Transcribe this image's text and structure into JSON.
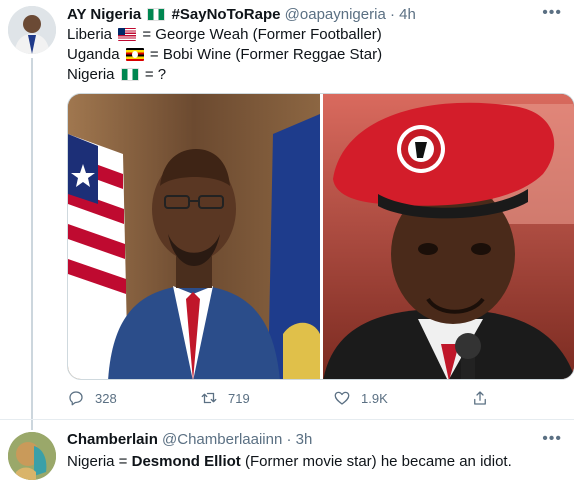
{
  "tweet": {
    "name": "AY Nigeria",
    "name_suffix": "#SayNoToRape",
    "handle": "@oapaynigeria",
    "separator": "·",
    "time": "4h",
    "lines": [
      {
        "prefix": "Liberia",
        "suffix": "= George Weah (Former Footballer)"
      },
      {
        "prefix": "Uganda",
        "suffix": "= Bobi Wine (Former Reggae Star)"
      },
      {
        "prefix": "Nigeria",
        "suffix": "= ?"
      }
    ],
    "flags": [
      "nigeria-flag-icon",
      "liberia-flag-icon",
      "uganda-flag-icon",
      "nigeria-flag-icon"
    ],
    "actions": {
      "replies": "328",
      "retweets": "719",
      "likes": "1.9K"
    }
  },
  "reply": {
    "name": "Chamberlain",
    "handle": "@Chamberlaaiinn",
    "separator": "·",
    "time": "3h",
    "text_before": "Nigeria =",
    "text_bold": "Desmond Elliot",
    "text_after": "(Former movie star) he became an idiot."
  },
  "colors": {
    "secondary_text": "#5b7083",
    "divider": "#e6ecf0"
  }
}
